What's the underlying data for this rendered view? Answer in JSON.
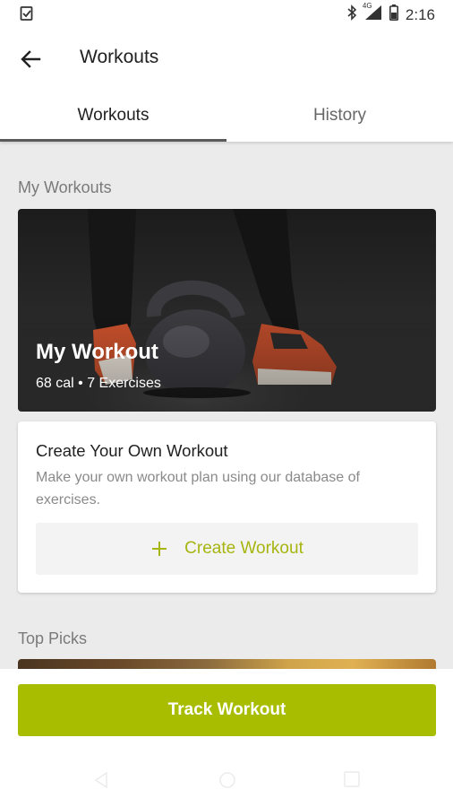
{
  "status_bar": {
    "time": "2:16",
    "network_label": "4G",
    "icons": [
      "clipboard-check-icon",
      "bluetooth-icon",
      "signal-icon",
      "battery-icon"
    ]
  },
  "app_bar": {
    "title": "Workouts",
    "back_icon": "arrow-left-icon"
  },
  "tabs": [
    {
      "label": "Workouts",
      "active": true
    },
    {
      "label": "History",
      "active": false
    }
  ],
  "my_workouts": {
    "heading": "My Workouts",
    "card": {
      "title": "My Workout",
      "meta": "68 cal • 7 Exercises"
    }
  },
  "create_card": {
    "title": "Create Your Own Workout",
    "description": "Make your own workout plan using our database of exercises.",
    "button_label": "Create Workout",
    "button_icon": "plus-icon"
  },
  "top_picks": {
    "heading": "Top Picks"
  },
  "track_button": {
    "label": "Track Workout"
  },
  "colors": {
    "accent": "#a8bd00",
    "accent_text": "#a6b50f",
    "background": "#ebebeb",
    "heading_gray": "#7a7a7a"
  },
  "nav_bar": {
    "icons": [
      "nav-back-icon",
      "nav-home-icon",
      "nav-recents-icon"
    ]
  }
}
